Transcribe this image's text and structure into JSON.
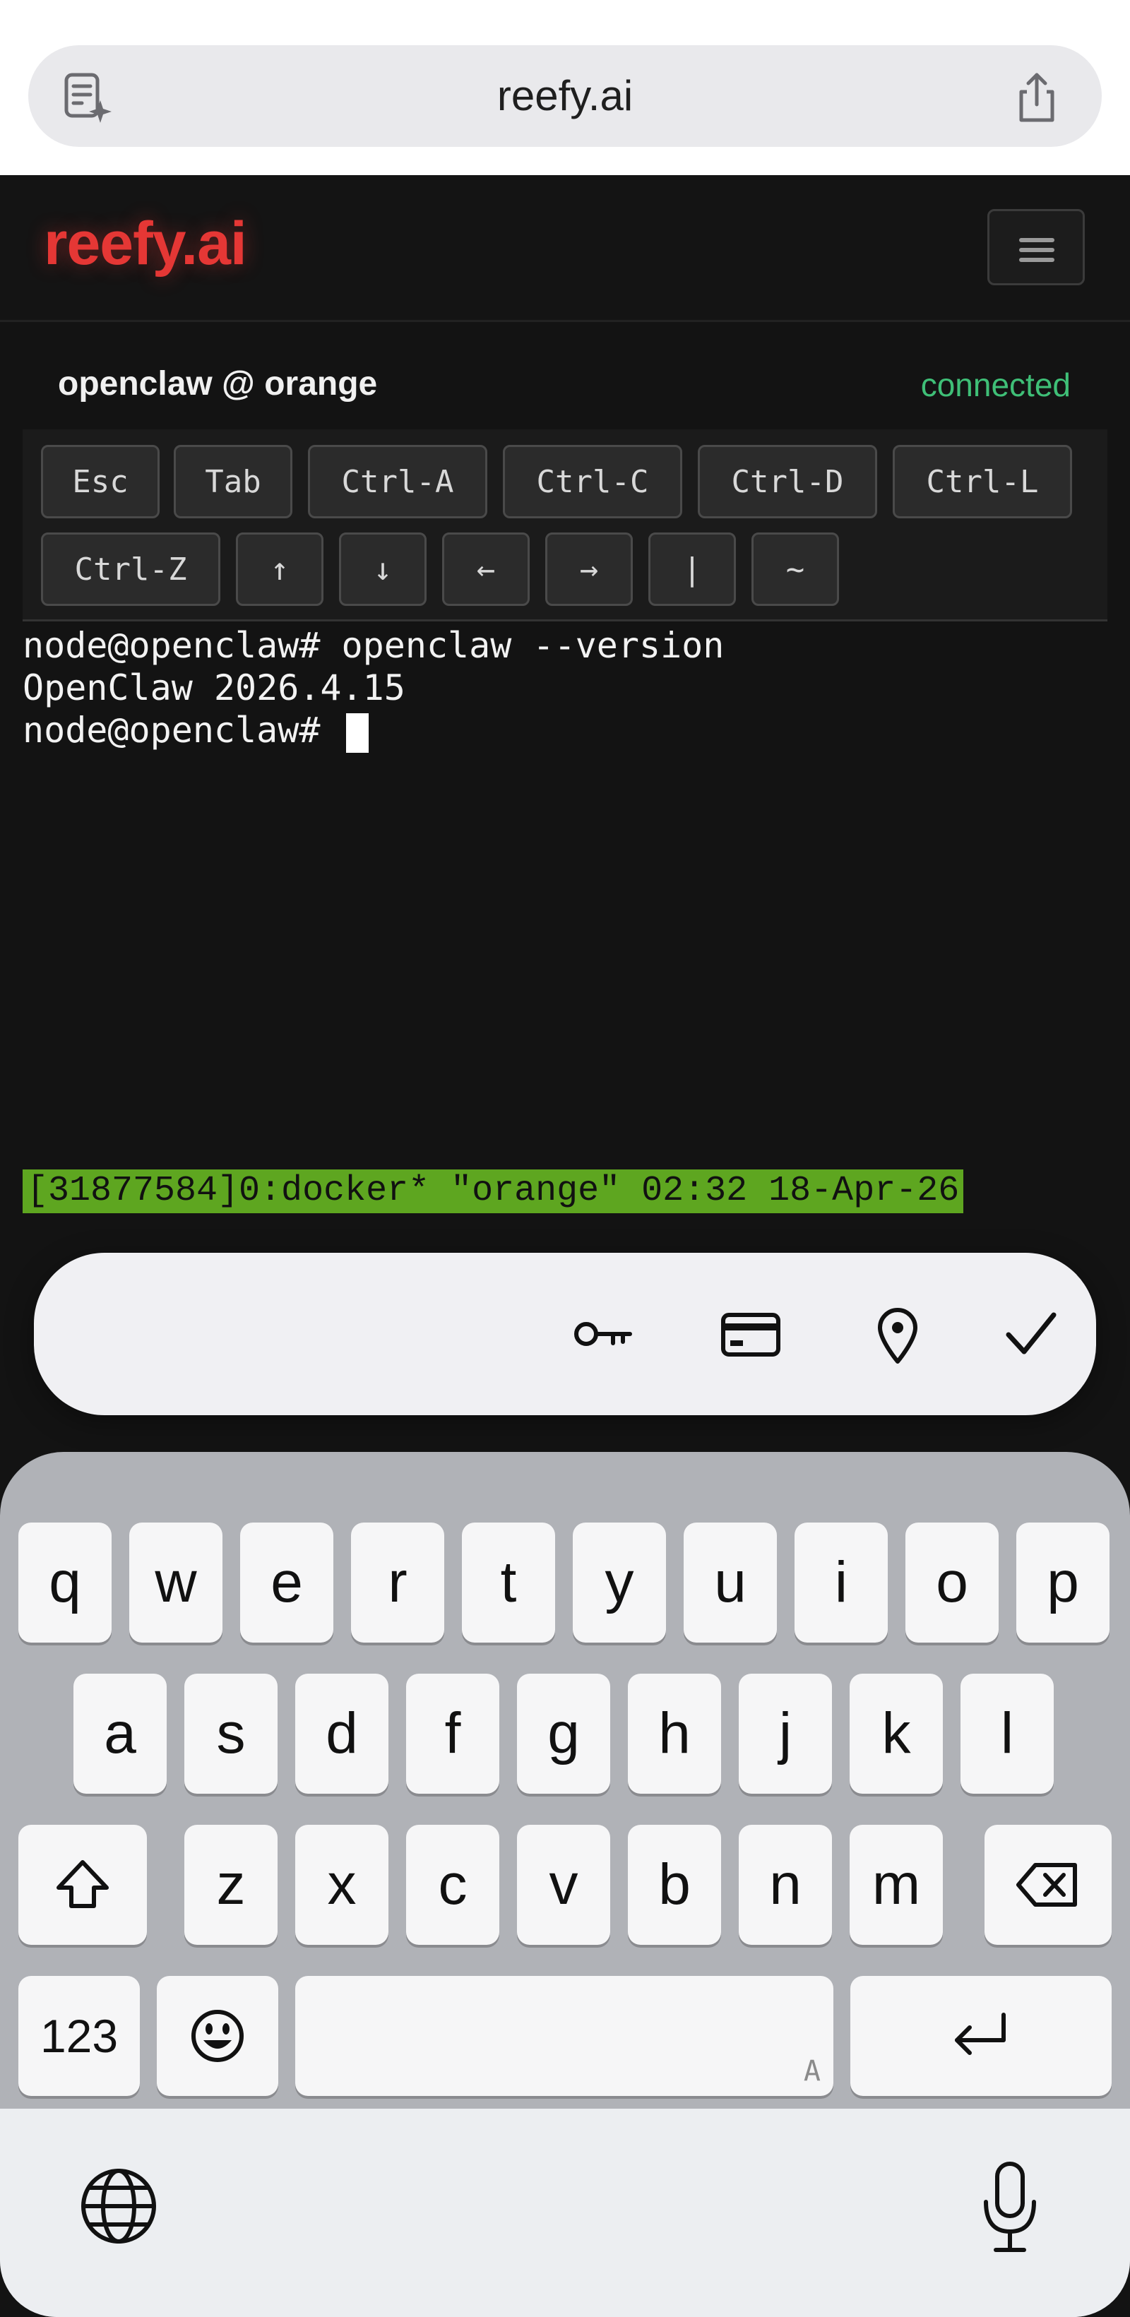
{
  "browser": {
    "url": "reefy.ai"
  },
  "site": {
    "brand": "reefy.ai",
    "brand_color": "#e53735"
  },
  "session": {
    "title": "openclaw @ orange",
    "status": "connected",
    "status_color": "#3fbf77"
  },
  "keybar": {
    "row1": [
      "Esc",
      "Tab",
      "Ctrl-A",
      "Ctrl-C",
      "Ctrl-D",
      "Ctrl-L"
    ],
    "row2": [
      "Ctrl-Z",
      "↑",
      "↓",
      "←",
      "→",
      "|",
      "~"
    ]
  },
  "terminal": {
    "lines": [
      "node@openclaw# openclaw --version",
      "OpenClaw 2026.4.15",
      "node@openclaw# "
    ],
    "status_bar": "[31877584]0:docker* \"orange\" 02:32 18-Apr-26",
    "status_bar_color": "#5ea620"
  },
  "autofill": {
    "icons": [
      "key-icon",
      "credit-card-icon",
      "location-pin-icon",
      "checkmark-icon"
    ]
  },
  "keyboard": {
    "row1": [
      "q",
      "w",
      "e",
      "r",
      "t",
      "y",
      "u",
      "i",
      "o",
      "p"
    ],
    "row2": [
      "a",
      "s",
      "d",
      "f",
      "g",
      "h",
      "j",
      "k",
      "l"
    ],
    "row3": [
      "z",
      "x",
      "c",
      "v",
      "b",
      "n",
      "m"
    ],
    "numbers_label": "123",
    "space_hint": "A"
  }
}
